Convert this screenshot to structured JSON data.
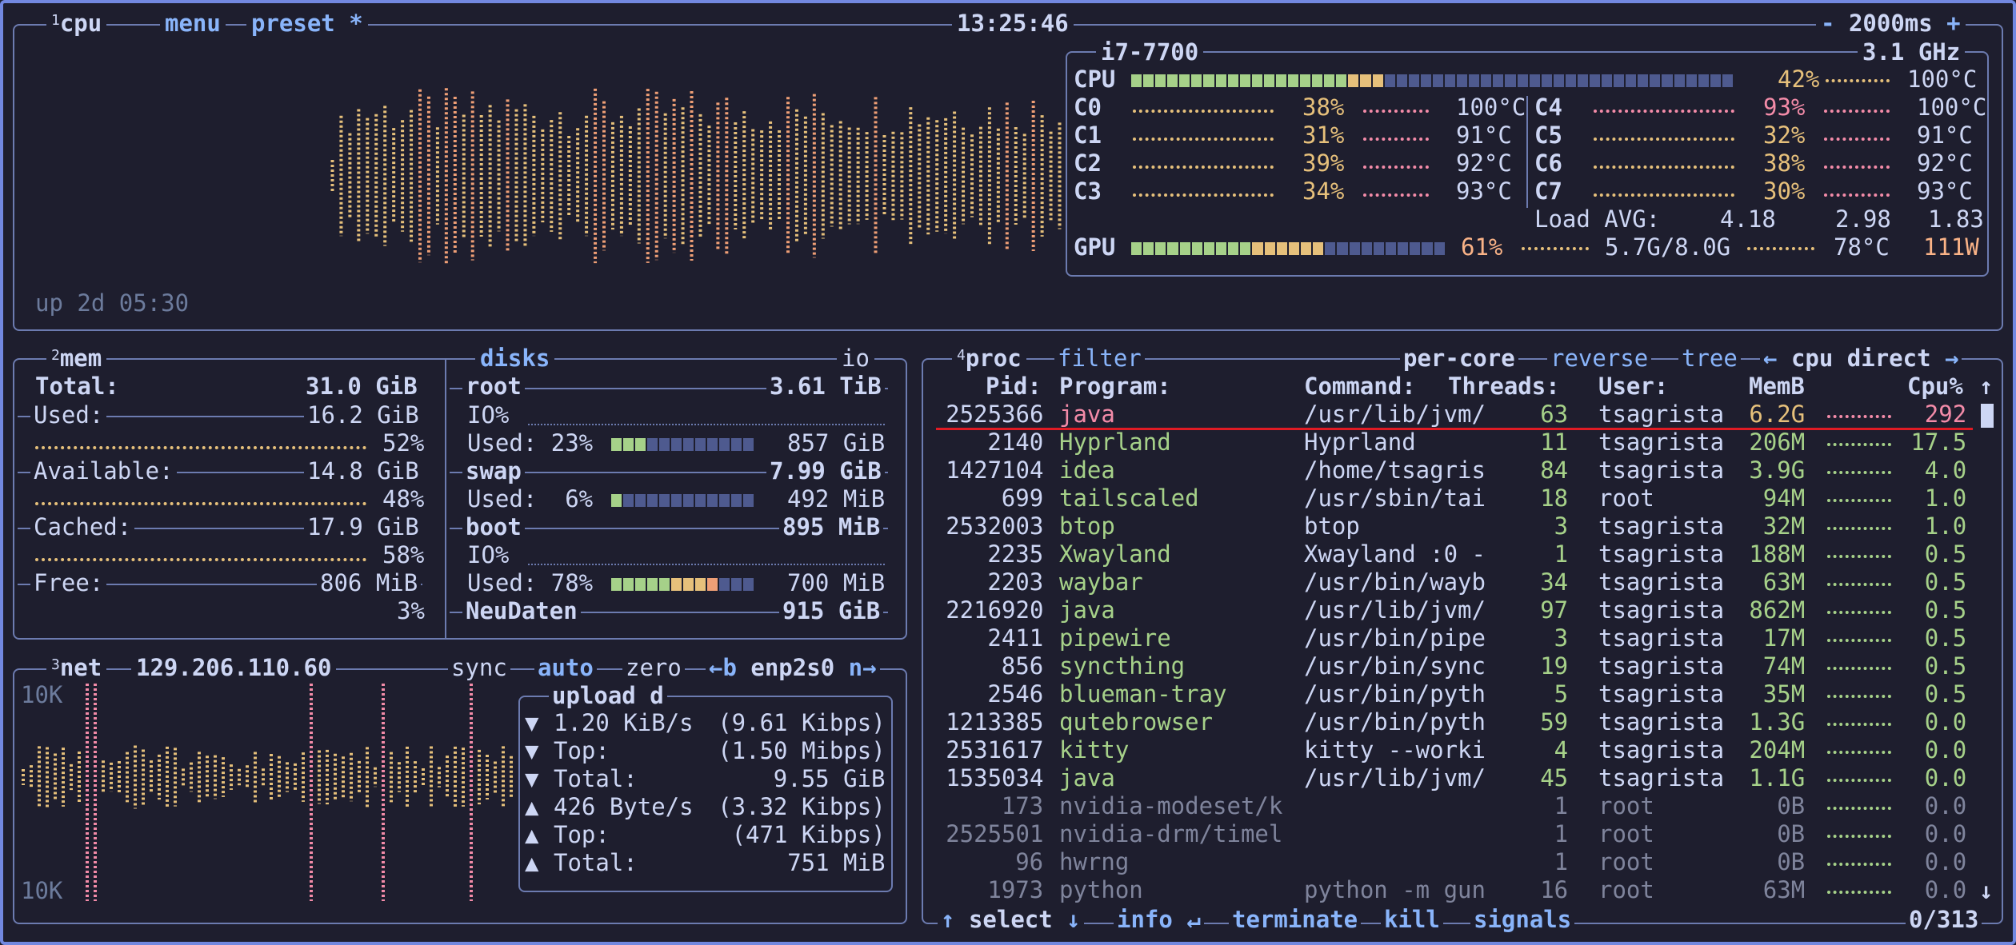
{
  "cpu_box": {
    "num": "1",
    "title": "cpu",
    "menu": "menu",
    "preset": "preset *",
    "clock": "13:25:46",
    "interval_minus": "-",
    "interval": "2000ms",
    "interval_plus": "+",
    "uptime": "up 2d 05:30",
    "model": "i7-7700",
    "freq": "3.1 GHz",
    "total_label": "CPU",
    "total_pct": "42%",
    "total_temp": "100°C",
    "total_fill": 0.42,
    "cores": [
      {
        "name": "C0",
        "pct": "38%",
        "temp": "100°C"
      },
      {
        "name": "C1",
        "pct": "31%",
        "temp": "91°C"
      },
      {
        "name": "C2",
        "pct": "39%",
        "temp": "92°C"
      },
      {
        "name": "C3",
        "pct": "34%",
        "temp": "93°C"
      },
      {
        "name": "C4",
        "pct": "93%",
        "temp": "100°C"
      },
      {
        "name": "C5",
        "pct": "32%",
        "temp": "91°C"
      },
      {
        "name": "C6",
        "pct": "38%",
        "temp": "92°C"
      },
      {
        "name": "C7",
        "pct": "30%",
        "temp": "93°C"
      }
    ],
    "load_label": "Load AVG:",
    "load1": "4.18",
    "load5": "2.98",
    "load15": "1.83",
    "gpu_label": "GPU",
    "gpu_pct": "61%",
    "gpu_mem": "5.7G/8.0G",
    "gpu_temp": "78°C",
    "gpu_power": "111W",
    "gpu_fill": 0.61
  },
  "mem_box": {
    "num": "2",
    "title": "mem",
    "total_label": "Total:",
    "total": "31.0 GiB",
    "used_label": "Used:",
    "used": "16.2 GiB",
    "used_pct": "52%",
    "avail_label": "Available:",
    "avail": "14.8 GiB",
    "avail_pct": "48%",
    "cached_label": "Cached:",
    "cached": "17.9 GiB",
    "cached_pct": "58%",
    "free_label": "Free:",
    "free": "806 MiB",
    "free_pct": "3%"
  },
  "disks_box": {
    "title": "disks",
    "io": "io",
    "root_label": "root",
    "root_size": "3.61 TiB",
    "root_io": "IO%",
    "root_used": "Used: 23%",
    "root_used_val": "857 GiB",
    "root_fill": 0.23,
    "swap_label": "swap",
    "swap_size": "7.99 GiB",
    "swap_used": "Used:  6%",
    "swap_used_val": "492 MiB",
    "swap_fill": 0.06,
    "boot_label": "boot",
    "boot_size": "895 MiB",
    "boot_io": "IO%",
    "boot_used": "Used: 78%",
    "boot_used_val": "700 MiB",
    "boot_fill": 0.78,
    "neu_label": "NeuDaten",
    "neu_size": "915 GiB"
  },
  "net_box": {
    "num": "3",
    "title": "net",
    "ip": "129.206.110.60",
    "sync": "sync",
    "auto": "auto",
    "zero": "zero",
    "prev": "←b",
    "iface": "enp2s0",
    "next": "n→",
    "scale_top": "10K",
    "scale_bottom": "10K",
    "upload_title": "upload",
    "download_title": "d",
    "rows": [
      {
        "arrow": "▼",
        "label": "1.20 KiB/s",
        "value": "(9.61 Kibps)"
      },
      {
        "arrow": "▼",
        "label": "Top:",
        "value": "(1.50 Mibps)"
      },
      {
        "arrow": "▼",
        "label": "Total:",
        "value": "9.55 GiB"
      },
      {
        "arrow": "▲",
        "label": "426 Byte/s",
        "value": "(3.32 Kibps)"
      },
      {
        "arrow": "▲",
        "label": "Top:",
        "value": "(471 Kibps)"
      },
      {
        "arrow": "▲",
        "label": "Total:",
        "value": "751 MiB"
      }
    ]
  },
  "proc_box": {
    "num": "4",
    "title": "proc",
    "filter": "filter",
    "per_core": "per-core",
    "reverse": "reverse",
    "tree": "tree",
    "sort_prev": "←",
    "sort": "cpu direct",
    "sort_next": "→",
    "headers": {
      "pid": "Pid:",
      "program": "Program:",
      "command": "Command:",
      "threads": "Threads:",
      "user": "User:",
      "mem": "MemB",
      "cpu": "Cpu%"
    },
    "rows": [
      {
        "pid": "2525366",
        "program": "java",
        "command": "/usr/lib/jvm/",
        "threads": "63",
        "user": "tsagrista",
        "mem": "6.2G",
        "cpu": "292",
        "color": "r"
      },
      {
        "pid": "2140",
        "program": "Hyprland",
        "command": "Hyprland",
        "threads": "11",
        "user": "tsagrista",
        "mem": "206M",
        "cpu": "17.5",
        "color": "g"
      },
      {
        "pid": "1427104",
        "program": "idea",
        "command": "/home/tsagris",
        "threads": "84",
        "user": "tsagrista",
        "mem": "3.9G",
        "cpu": "4.0",
        "color": "g"
      },
      {
        "pid": "699",
        "program": "tailscaled",
        "command": "/usr/sbin/tai",
        "threads": "18",
        "user": "root",
        "mem": "94M",
        "cpu": "1.0",
        "color": "g"
      },
      {
        "pid": "2532003",
        "program": "btop",
        "command": "btop",
        "threads": "3",
        "user": "tsagrista",
        "mem": "32M",
        "cpu": "1.0",
        "color": "g"
      },
      {
        "pid": "2235",
        "program": "Xwayland",
        "command": "Xwayland :0 -",
        "threads": "1",
        "user": "tsagrista",
        "mem": "188M",
        "cpu": "0.5",
        "color": "g"
      },
      {
        "pid": "2203",
        "program": "waybar",
        "command": "/usr/bin/wayb",
        "threads": "34",
        "user": "tsagrista",
        "mem": "63M",
        "cpu": "0.5",
        "color": "g"
      },
      {
        "pid": "2216920",
        "program": "java",
        "command": "/usr/lib/jvm/",
        "threads": "97",
        "user": "tsagrista",
        "mem": "862M",
        "cpu": "0.5",
        "color": "g"
      },
      {
        "pid": "2411",
        "program": "pipewire",
        "command": "/usr/bin/pipe",
        "threads": "3",
        "user": "tsagrista",
        "mem": "17M",
        "cpu": "0.5",
        "color": "g"
      },
      {
        "pid": "856",
        "program": "syncthing",
        "command": "/usr/bin/sync",
        "threads": "19",
        "user": "tsagrista",
        "mem": "74M",
        "cpu": "0.5",
        "color": "g"
      },
      {
        "pid": "2546",
        "program": "blueman-tray",
        "command": "/usr/bin/pyth",
        "threads": "5",
        "user": "tsagrista",
        "mem": "35M",
        "cpu": "0.5",
        "color": "g"
      },
      {
        "pid": "1213385",
        "program": "qutebrowser",
        "command": "/usr/bin/pyth",
        "threads": "59",
        "user": "tsagrista",
        "mem": "1.3G",
        "cpu": "0.0",
        "color": "g"
      },
      {
        "pid": "2531617",
        "program": "kitty",
        "command": "kitty --worki",
        "threads": "4",
        "user": "tsagrista",
        "mem": "204M",
        "cpu": "0.0",
        "color": "g"
      },
      {
        "pid": "1535034",
        "program": "java",
        "command": "/usr/lib/jvm/",
        "threads": "45",
        "user": "tsagrista",
        "mem": "1.1G",
        "cpu": "0.0",
        "color": "g"
      },
      {
        "pid": "173",
        "program": "nvidia-modeset/k",
        "command": "",
        "threads": "1",
        "user": "root",
        "mem": "0B",
        "cpu": "0.0",
        "color": "m"
      },
      {
        "pid": "2525501",
        "program": "nvidia-drm/timel",
        "command": "",
        "threads": "1",
        "user": "root",
        "mem": "0B",
        "cpu": "0.0",
        "color": "m"
      },
      {
        "pid": "96",
        "program": "hwrng",
        "command": "",
        "threads": "1",
        "user": "root",
        "mem": "0B",
        "cpu": "0.0",
        "color": "m"
      },
      {
        "pid": "1973",
        "program": "python",
        "command": "python -m gun",
        "threads": "16",
        "user": "root",
        "mem": "63M",
        "cpu": "0.0",
        "color": "m"
      }
    ],
    "footer": {
      "up": "↑",
      "select": "select",
      "down": "↓",
      "info": "info",
      "enter": "↵",
      "terminate": "terminate",
      "kill": "kill",
      "signals": "signals",
      "count": "0/313"
    },
    "scroll_up": "↑",
    "scroll_down": "↓"
  },
  "colors": {
    "bg": "#1e1e2e",
    "border": "#6c7bb0",
    "accent": "#89b4fa",
    "green": "#a6d189",
    "yellow": "#e6c07b",
    "red": "#f38ba8"
  }
}
